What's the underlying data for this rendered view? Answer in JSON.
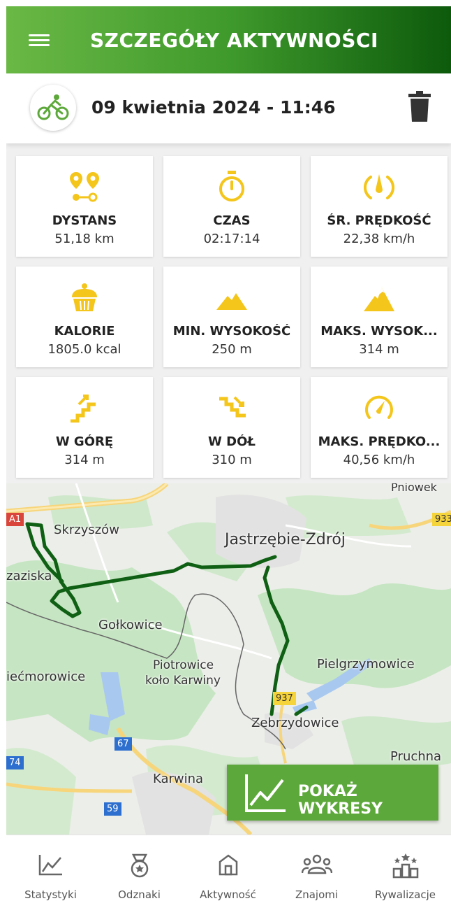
{
  "appbar": {
    "title": "SZCZEGÓŁY AKTYWNOŚCI"
  },
  "activity": {
    "date": "09 kwietnia 2024 - 11:46"
  },
  "stats": [
    {
      "label": "DYSTANS",
      "value": "51,18 km",
      "icon": "distance-pins-icon"
    },
    {
      "label": "CZAS",
      "value": "02:17:14",
      "icon": "stopwatch-icon"
    },
    {
      "label": "ŚR. PRĘDKOŚĆ",
      "value": "22,38 km/h",
      "icon": "avg-speed-icon"
    },
    {
      "label": "KALORIE",
      "value": "1805.0 kcal",
      "icon": "cupcake-icon"
    },
    {
      "label": "MIN. WYSOKOŚĆ",
      "value": "250 m",
      "icon": "low-mountain-icon"
    },
    {
      "label": "MAKS. WYSOK...",
      "value": "314 m",
      "icon": "high-mountain-icon"
    },
    {
      "label": "W GÓRĘ",
      "value": "314 m",
      "icon": "stairs-up-icon"
    },
    {
      "label": "W DÓŁ",
      "value": "310 m",
      "icon": "stairs-down-icon"
    },
    {
      "label": "MAKS. PRĘDKO...",
      "value": "40,56 km/h",
      "icon": "speedometer-icon"
    }
  ],
  "map": {
    "places": {
      "skrzyszow": "Skrzyszów",
      "jastrzebie": "Jastrzębie-Zdrój",
      "zaziska": "zaziska",
      "golkowice": "Gołkowice",
      "piotrowice1": "Piotrowice",
      "piotrowice2": "koło Karwiny",
      "piecmorowice": "iećmorowice",
      "pielgrzymowice": "Pielgrzymowice",
      "zebrzydowice": "Zebrzydowice",
      "pruchna": "Pruchna",
      "karwina": "Karwina",
      "pniowek": "Pniowek"
    },
    "roads": {
      "a1": "A1",
      "r933": "933",
      "r937": "937",
      "r67": "67",
      "r74": "74",
      "r59": "59"
    },
    "show_charts_label": "POKAŻ WYKRESY"
  },
  "nav": [
    {
      "label": "Statystyki",
      "icon": "chart-line-icon"
    },
    {
      "label": "Odznaki",
      "icon": "medal-icon"
    },
    {
      "label": "Aktywność",
      "icon": "home-icon"
    },
    {
      "label": "Znajomi",
      "icon": "friends-icon"
    },
    {
      "label": "Rywalizacje",
      "icon": "ranking-icon"
    }
  ],
  "colors": {
    "brand_green": "#5da83a",
    "icon_yellow": "#f4c51a",
    "route_green": "#0f5f14"
  }
}
